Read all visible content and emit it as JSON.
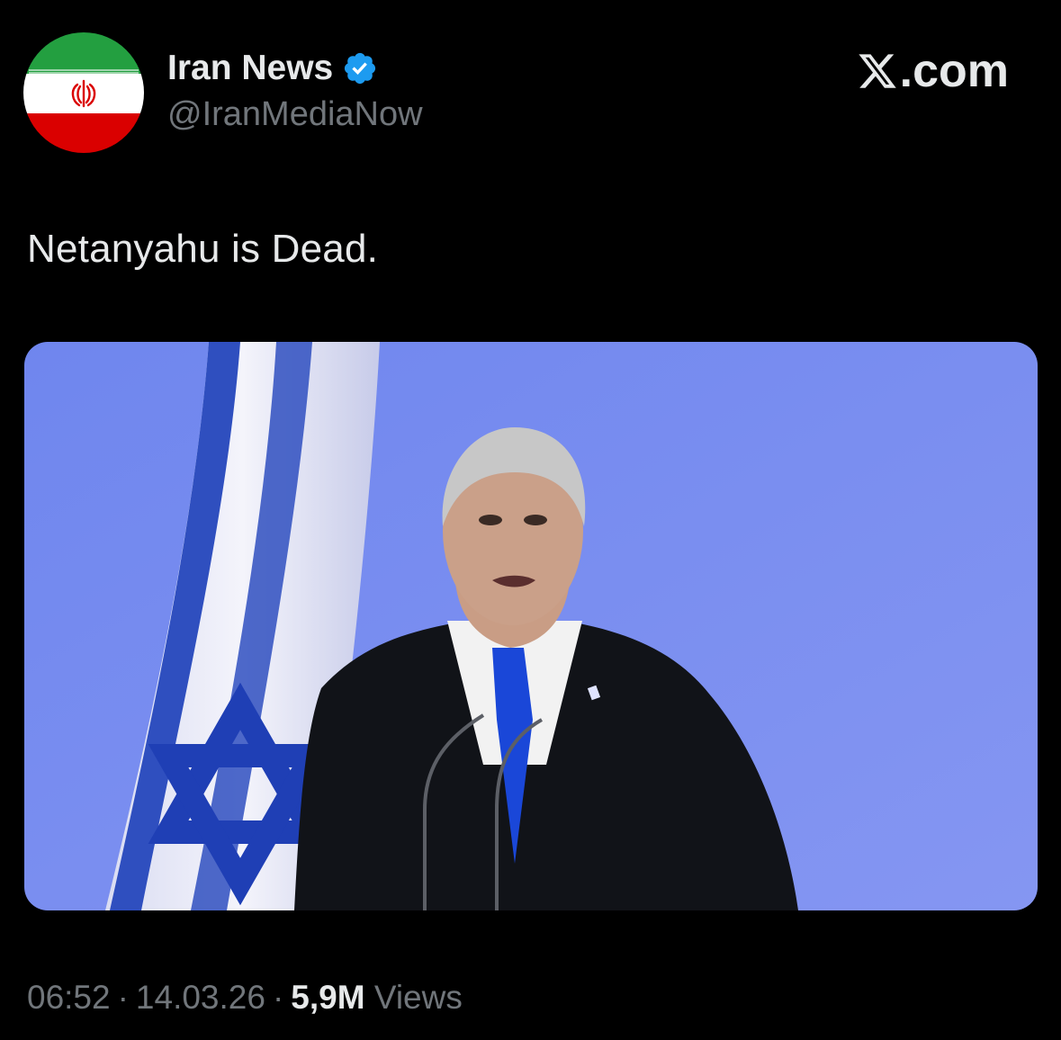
{
  "author": {
    "display_name": "Iran News",
    "handle": "@IranMediaNow",
    "verified_icon": "verified-badge-icon",
    "avatar": "iran-flag-avatar",
    "avatar_colors": {
      "green": "#239f40",
      "white": "#ffffff",
      "red": "#da0000"
    }
  },
  "brand": {
    "logo_icon": "x-logo-icon",
    "suffix": ".com"
  },
  "tweet": {
    "text": "Netanyahu is Dead.",
    "media": {
      "description_icon": "press-conference-photo",
      "background_color": "#7b8ef0",
      "flag": "israel-flag"
    }
  },
  "meta": {
    "time": "06:52",
    "separator": "·",
    "date": "14.03.26",
    "views_count": "5,9M",
    "views_label": "Views"
  },
  "colors": {
    "background": "#000000",
    "primary_text": "#e7e9ea",
    "secondary_text": "#71767b",
    "verified_blue": "#1d9bf0"
  }
}
